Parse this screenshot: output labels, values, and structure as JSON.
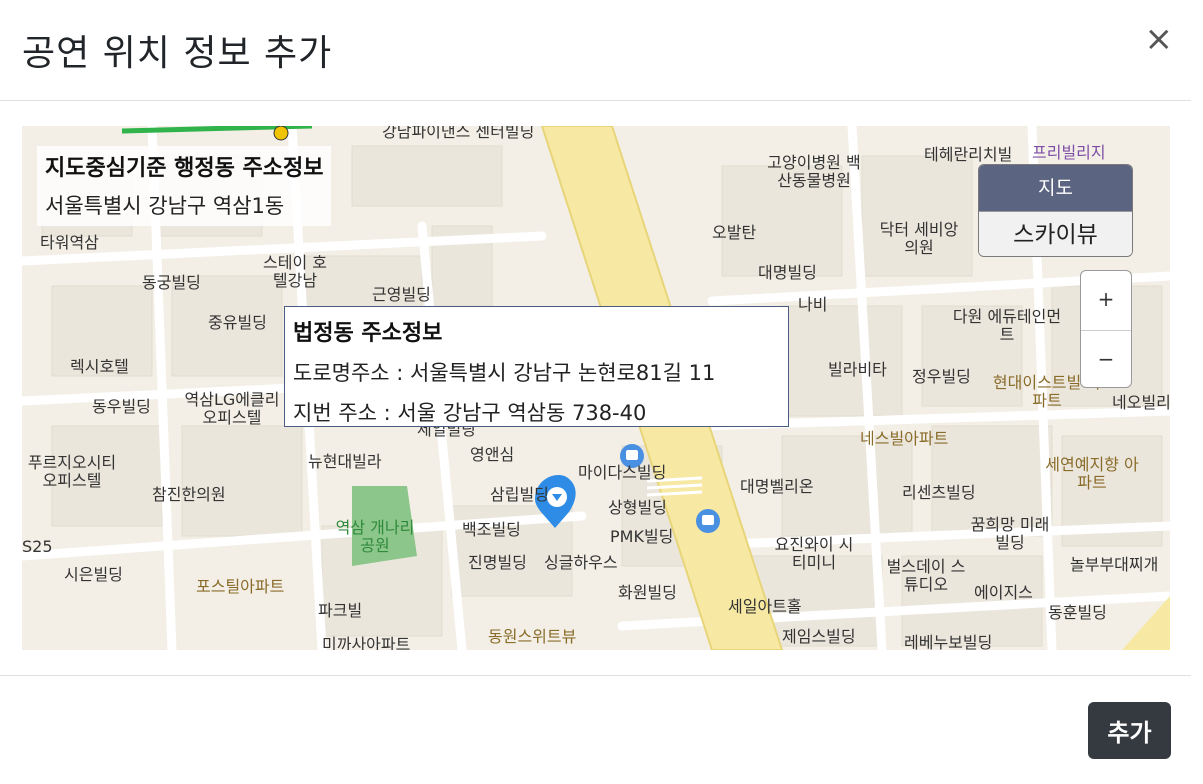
{
  "modal": {
    "title": "공연 위치 정보 추가",
    "close_label": "×"
  },
  "map": {
    "center_address": {
      "title": "지도중심기준 행정동 주소정보",
      "value": "서울특별시 강남구 역삼1동"
    },
    "popup": {
      "title": "법정동 주소정보",
      "road_address": "도로명주소 : 서울특별시 강남구 논현로81길 11",
      "lot_address": "지번 주소 : 서울 강남구 역삼동 738-40"
    },
    "map_type": {
      "active": "지도",
      "inactive": "스카이뷰"
    },
    "zoom": {
      "in": "+",
      "out": "−"
    },
    "labels": [
      "강남파이낸스 센터빌딩",
      "타워역삼",
      "동궁빌딩",
      "스테이 호텔강남",
      "근영빌딩",
      "고양이병원 백산동물병원",
      "테헤란리치빌",
      "프리빌리지",
      "오발탄",
      "닥터 세비앙의원",
      "대명빌딩",
      "나비",
      "중유빌딩",
      "렉시호텔",
      "동우빌딩",
      "역삼LG에클리 오피스텔",
      "세일빌딩",
      "뉴현대빌라",
      "영앤심",
      "마이다스빌딩",
      "삼립빌딩",
      "빌라비타",
      "정우빌딩",
      "현대이스트빌 아파트",
      "네오빌리",
      "다원 에듀테인먼트",
      "네스빌아파트",
      "세연예지향 아파트",
      "리센츠빌딩",
      "대명벨리온",
      "상형빌딩",
      "푸르지오시티 오피스텔",
      "참진한의원",
      "역삼 개나리공원",
      "백조빌딩",
      "PMK빌딩",
      "진명빌딩",
      "싱글하우스",
      "요진와이 시티미니",
      "벌스데이 스튜디오",
      "꿈희망 미래빌딩",
      "놀부부대찌개",
      "시은빌딩",
      "포스틸아파트",
      "파크빌",
      "화원빌딩",
      "세일아트홀",
      "에이지스",
      "동훈빌딩",
      "동원스위트뷰",
      "제임스빌딩",
      "레베누보빌딩",
      "미까사아파트",
      "S25"
    ]
  },
  "footer": {
    "add_label": "추가"
  },
  "colors": {
    "primary_button": "#343a40",
    "main_road": "#f7e9a3",
    "park": "#8cc68a",
    "marker": "#2e8ce6",
    "bus_stop": "#4a90e2"
  },
  "icons": [
    "close-icon",
    "map-marker-icon",
    "bus-stop-icon"
  ]
}
